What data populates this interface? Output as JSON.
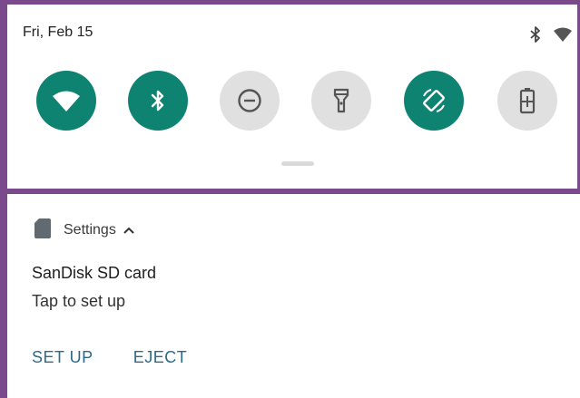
{
  "status_bar": {
    "date": "Fri, Feb 15",
    "icons": [
      "bluetooth-icon",
      "wifi-icon"
    ]
  },
  "quick_settings": {
    "tiles": [
      {
        "icon": "wifi-icon",
        "state": "on"
      },
      {
        "icon": "bluetooth-icon",
        "state": "on"
      },
      {
        "icon": "do-not-disturb-icon",
        "state": "off"
      },
      {
        "icon": "flashlight-icon",
        "state": "off"
      },
      {
        "icon": "auto-rotate-icon",
        "state": "on"
      },
      {
        "icon": "battery-saver-icon",
        "state": "off"
      }
    ],
    "colors": {
      "active": "#0f8372",
      "inactive": "#e0e0e0"
    }
  },
  "notification": {
    "app_name": "Settings",
    "app_icon": "sd-card-icon",
    "title": "SanDisk SD card",
    "text": "Tap to set up",
    "actions": [
      {
        "label": "SET UP"
      },
      {
        "label": "EJECT"
      }
    ]
  }
}
